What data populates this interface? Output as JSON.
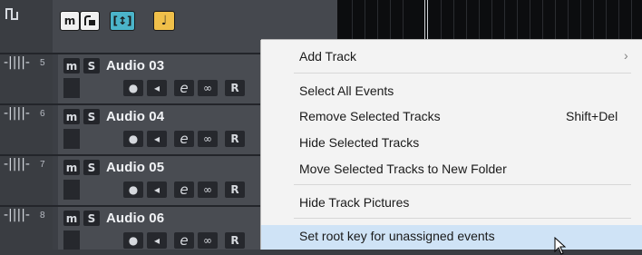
{
  "header": {
    "icons": {
      "track_list_icon": "square-wave-icon",
      "m_button": "m",
      "lock_icon": "lock-icon",
      "split_icon": "split-arrows-icon",
      "note_icon": "note-icon"
    },
    "colors": {
      "accent_teal": "#4bb4c9",
      "accent_amber": "#f0c04a"
    }
  },
  "tracks": [
    {
      "number": "5",
      "name": "Audio 03",
      "mute": "m",
      "solo": "S",
      "record": "●",
      "monitor": "◂",
      "edit": "e",
      "link": "∞",
      "read": "R"
    },
    {
      "number": "6",
      "name": "Audio 04",
      "mute": "m",
      "solo": "S",
      "record": "●",
      "monitor": "◂",
      "edit": "e",
      "link": "∞",
      "read": "R"
    },
    {
      "number": "7",
      "name": "Audio 05",
      "mute": "m",
      "solo": "S",
      "record": "●",
      "monitor": "◂",
      "edit": "e",
      "link": "∞",
      "read": "R"
    },
    {
      "number": "8",
      "name": "Audio 06",
      "mute": "m",
      "solo": "S",
      "record": "●",
      "monitor": "◂",
      "edit": "e",
      "link": "∞",
      "read": "R"
    }
  ],
  "context_menu": {
    "items": [
      {
        "label": "Add Track",
        "submenu_arrow": "›"
      },
      {
        "label": "Select All Events"
      },
      {
        "label": "Remove Selected Tracks",
        "shortcut": "Shift+Del"
      },
      {
        "label": "Hide Selected Tracks"
      },
      {
        "label": "Move Selected Tracks to New Folder"
      },
      {
        "label": "Hide Track Pictures"
      },
      {
        "label": "Set root key for unassigned events"
      }
    ],
    "highlight_color": "#cfe3f6"
  }
}
